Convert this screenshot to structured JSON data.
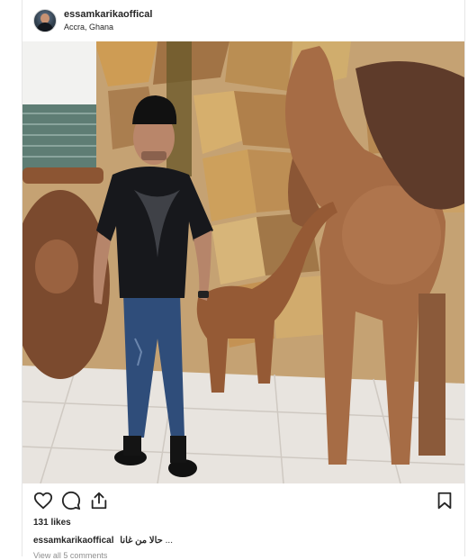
{
  "post": {
    "username": "essamkarikaoffical",
    "location": "Accra, Ghana",
    "likes": "131 likes",
    "caption": {
      "username": "essamkarikaoffical",
      "text": "حالا من غانا",
      "more": "..."
    },
    "comments_link": "View all 5 comments"
  },
  "icons": {
    "like": "heart-icon",
    "comment": "comment-bubble-icon",
    "share": "share-upload-icon",
    "save": "bookmark-icon"
  },
  "colors": {
    "text": "#262626",
    "muted": "#8e8e8e",
    "border": "#e6e6e6"
  }
}
